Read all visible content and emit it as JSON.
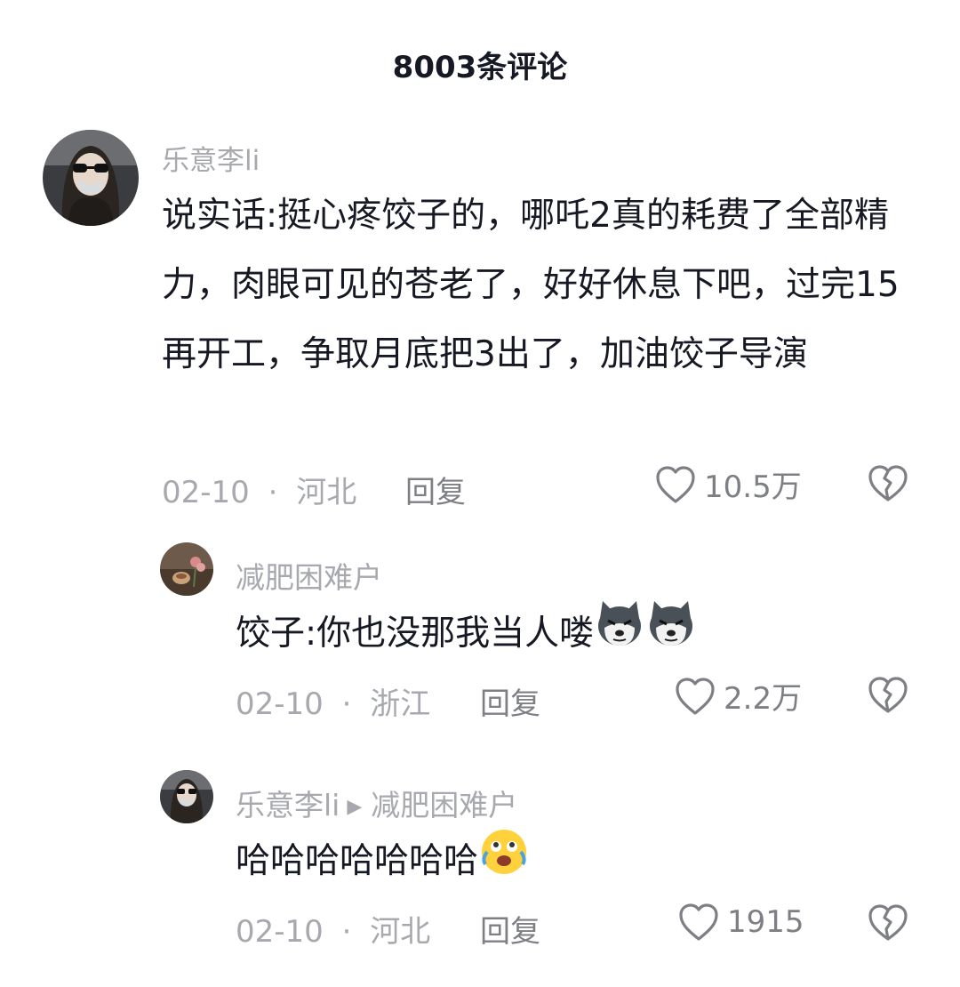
{
  "header": {
    "title": "8003条评论"
  },
  "comments": [
    {
      "author": "乐意李li",
      "text": "说实话:挺心疼饺子的，哪吒2真的耗费了全部精力，肉眼可见的苍老了，好好休息下吧，过完15再开工，争取月底把3出了，加油饺子导演",
      "date": "02-10",
      "dot": "·",
      "location": "河北",
      "reply_label": "回复",
      "likes": "10.5万"
    },
    {
      "author": "减肥困难户",
      "text": "饺子:你也没那我当人喽",
      "emoji": [
        "husky-emoji",
        "husky-emoji"
      ],
      "date": "02-10",
      "dot": "·",
      "location": "浙江",
      "reply_label": "回复",
      "likes": "2.2万"
    },
    {
      "author": "乐意李li",
      "reply_to": "减肥困难户",
      "text": "哈哈哈哈哈哈哈",
      "emoji": [
        "tears-of-joy-emoji"
      ],
      "date": "02-10",
      "dot": "·",
      "location": "河北",
      "reply_label": "回复",
      "likes": "1915"
    }
  ],
  "icons": {
    "like": "heart-outline-icon",
    "dislike": "broken-heart-icon"
  }
}
